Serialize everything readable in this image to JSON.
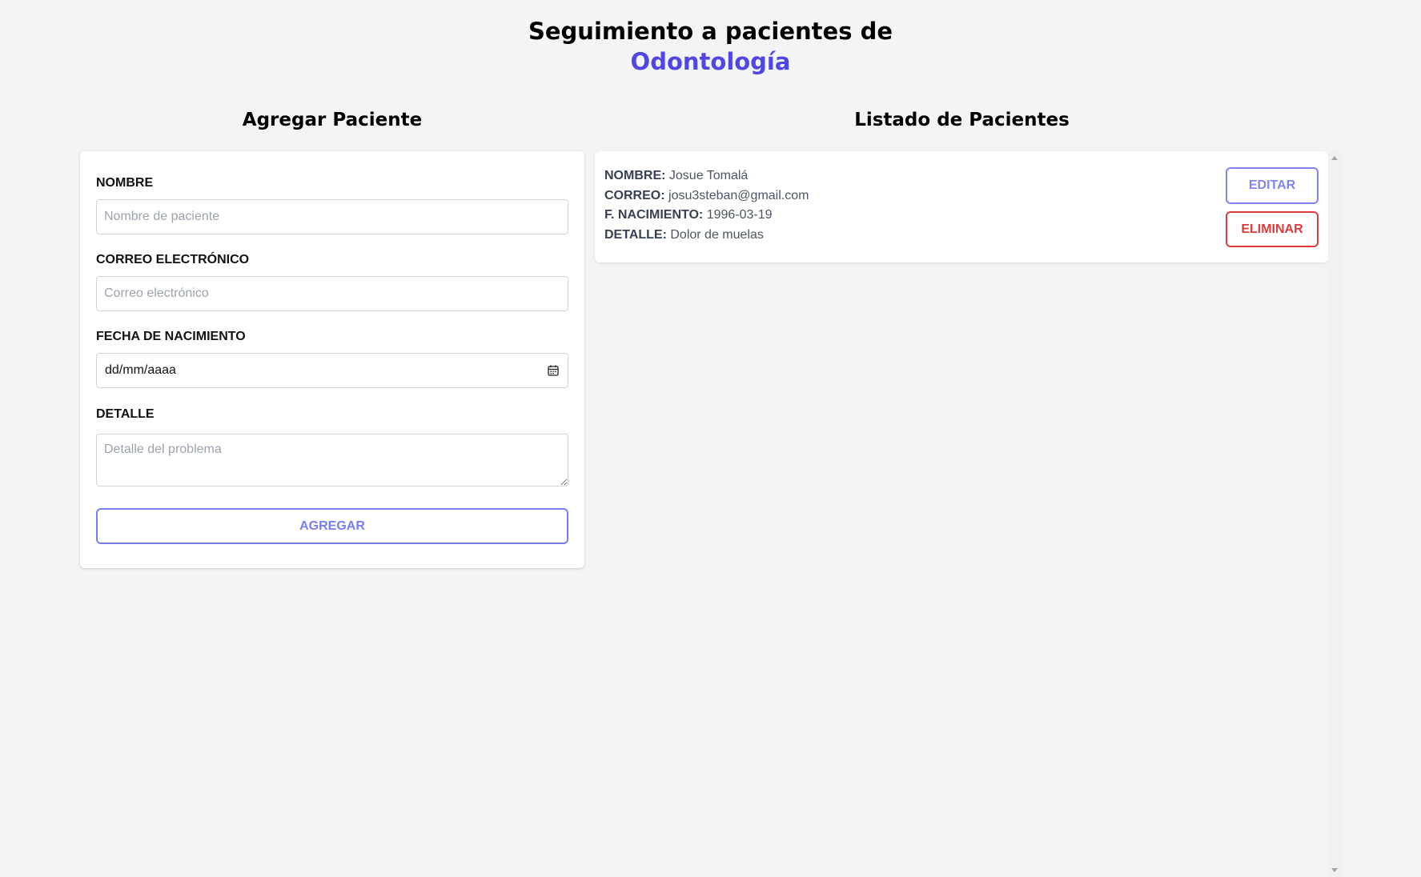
{
  "header": {
    "title_line1": "Seguimiento a pacientes de",
    "title_line2": "Odontología",
    "accent_color": "#4f46e5"
  },
  "form": {
    "heading": "Agregar Paciente",
    "name_label": "NOMBRE",
    "name_placeholder": "Nombre de paciente",
    "email_label": "CORREO ELECTRÓNICO",
    "email_placeholder": "Correo electrónico",
    "birth_label": "FECHA DE NACIMIENTO",
    "birth_placeholder": "dd/mm/aaaa",
    "detail_label": "DETALLE",
    "detail_placeholder": "Detalle del problema",
    "submit_label": "AGREGAR",
    "icons": {
      "calendar": "calendar-icon"
    }
  },
  "list": {
    "heading": "Listado de Pacientes",
    "patients": [
      {
        "name_key": "NOMBRE:",
        "name": "Josue Tomalá",
        "email_key": "CORREO:",
        "email": "josu3steban@gmail.com",
        "birth_key": "F. NACIMIENTO:",
        "birth": "1996-03-19",
        "detail_key": "DETALLE:",
        "detail": "Dolor de muelas",
        "edit_label": "EDITAR",
        "delete_label": "ELIMINAR"
      }
    ]
  },
  "colors": {
    "primary": "#6366f1",
    "danger": "#dc2626",
    "background": "#f3f4f6"
  }
}
